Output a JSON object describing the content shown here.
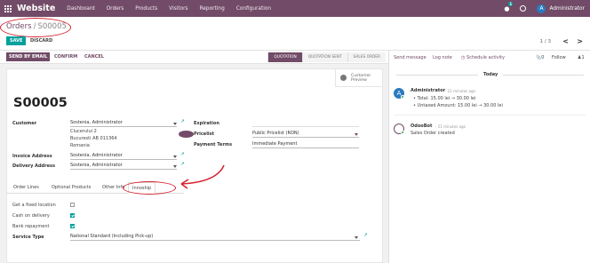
{
  "topbar": {
    "brand": "Website",
    "menu": [
      "Dashboard",
      "Orders",
      "Products",
      "Visitors",
      "Reporting",
      "Configuration"
    ],
    "chat_badge": "1",
    "user_initial": "A",
    "user_name": "Administrator"
  },
  "control": {
    "breadcrumb_root": "Orders",
    "breadcrumb_sep": "/",
    "breadcrumb_current": "S00005",
    "save": "SAVE",
    "discard": "DISCARD",
    "pager": "1 / 3",
    "prev": "<",
    "next": ">"
  },
  "statusbar": {
    "send_email": "SEND BY EMAIL",
    "confirm": "CONFIRM",
    "cancel": "CANCEL",
    "stages": [
      "QUOTATION",
      "QUOTATION SENT",
      "SALES ORDER"
    ],
    "active_stage": "QUOTATION"
  },
  "form": {
    "customer_preview_line1": "Customer",
    "customer_preview_line2": "Preview",
    "name": "S00005",
    "customer_label": "Customer",
    "customer_value": "Sostenia, Administrator",
    "address": [
      "Clucerului 2",
      "Bucuresti AB 011364",
      "Romania"
    ],
    "invoice_label": "Invoice Address",
    "invoice_value": "Sostenia, Administrator",
    "delivery_label": "Delivery Address",
    "delivery_value": "Sostenia, Administrator",
    "expiration_label": "Expiration",
    "pricelist_label": "Pricelist",
    "pricelist_value": "Public Pricelist (RON)",
    "terms_label": "Payment Terms",
    "terms_value": "Immediate Payment",
    "tabs": [
      "Order Lines",
      "Optional Products",
      "Other Info",
      "Innoship"
    ],
    "active_tab": "Innoship",
    "fixed_location_label": "Get a fixed location",
    "cod_label": "Cash on delivery",
    "bank_label": "Bank repayment",
    "service_label": "Service Type",
    "service_value": "National Standard (Including Pick-up)"
  },
  "chatter": {
    "send_message": "Send message",
    "log_note": "Log note",
    "schedule": "Schedule activity",
    "attachments": "0",
    "follow": "Follow",
    "followers": "1",
    "today": "Today",
    "msg1_author": "Administrator",
    "msg1_date": "- 21 minutes ago",
    "msg1_lines": [
      "Total: 15.00 lei → 30.00 lei",
      "Untaxed Amount: 15.00 lei → 30.00 lei"
    ],
    "msg2_author": "OdooBot",
    "msg2_date": "- 21 minutes ago",
    "msg2_text": "Sales Order created"
  },
  "colors": {
    "brand": "#714b67",
    "accent": "#00a09d",
    "annotation": "#d5222f"
  }
}
